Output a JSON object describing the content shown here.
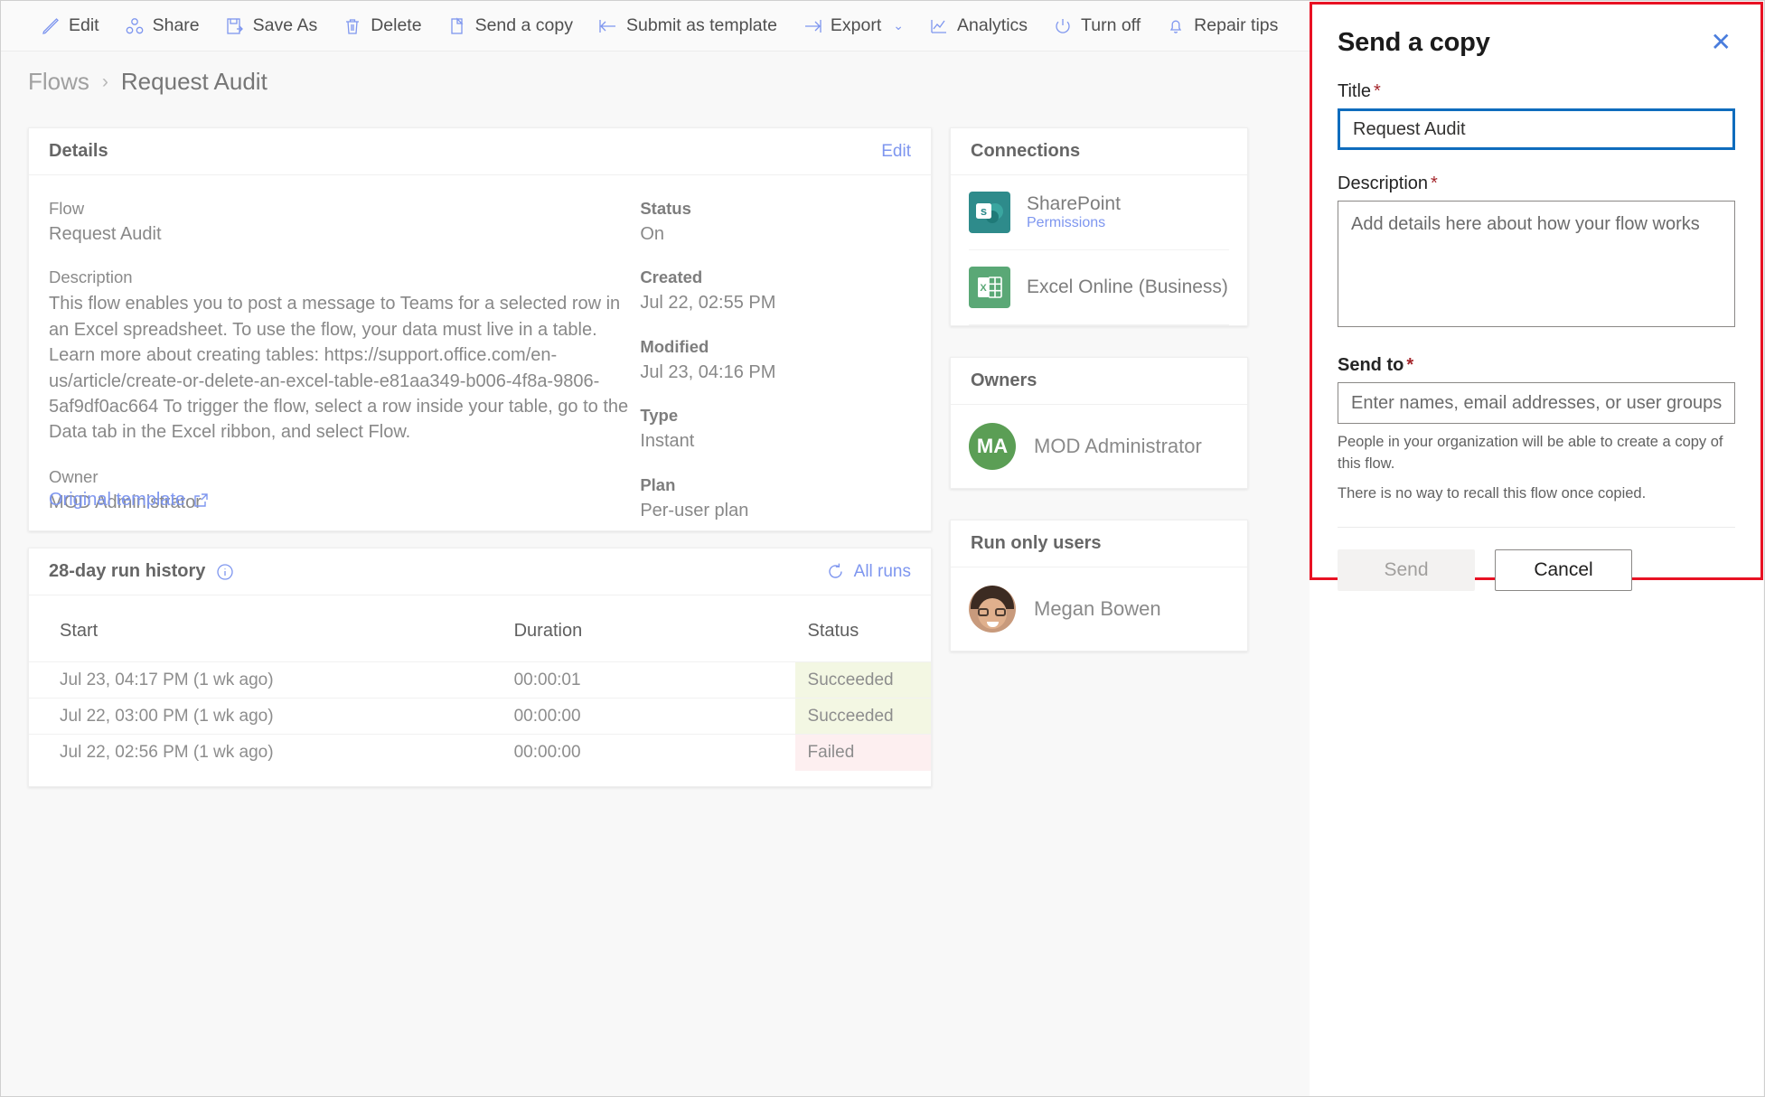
{
  "colors": {
    "accent_blue": "#7e96ef",
    "focus_blue": "#0f6cbd",
    "dialog_outline_red": "#e81123",
    "required_red": "#a4262c",
    "success_bg": "#f3f7e3",
    "failed_bg": "#fdeff0",
    "sharepoint_teal": "#2e8b8b",
    "excel_green": "#5aa876",
    "avatar_green": "#5b9e55"
  },
  "commandbar": {
    "items": [
      {
        "label": "Edit",
        "icon": "pencil-icon"
      },
      {
        "label": "Share",
        "icon": "share-icon"
      },
      {
        "label": "Save As",
        "icon": "save-as-icon"
      },
      {
        "label": "Delete",
        "icon": "trash-icon"
      },
      {
        "label": "Send a copy",
        "icon": "copy-icon"
      },
      {
        "label": "Submit as template",
        "icon": "arrow-left-bar-icon"
      },
      {
        "label": "Export",
        "icon": "arrow-right-bar-icon",
        "chevron": "⌄"
      },
      {
        "label": "Analytics",
        "icon": "chart-line-icon"
      },
      {
        "label": "Turn off",
        "icon": "power-icon"
      },
      {
        "label": "Repair tips",
        "icon": "bell-icon"
      }
    ]
  },
  "breadcrumb": {
    "parent": "Flows",
    "separator": "›",
    "current": "Request Audit"
  },
  "details": {
    "card_title": "Details",
    "edit_link": "Edit",
    "left": [
      {
        "label": "Flow",
        "value": "Request Audit"
      },
      {
        "label": "Description",
        "value": "This flow enables you to post a message to Teams for a selected row in an Excel spreadsheet. To use the flow, your data must live in a table. Learn more about creating tables: https://support.office.com/en-us/article/create-or-delete-an-excel-table-e81aa349-b006-4f8a-9806-5af9df0ac664 To trigger the flow, select a row inside your table, go to the Data tab in the Excel ribbon, and select Flow."
      },
      {
        "label": "Owner",
        "value": "MOD Administrator"
      }
    ],
    "right": [
      {
        "label": "Status",
        "value": "On"
      },
      {
        "label": "Created",
        "value": "Jul 22, 02:55 PM"
      },
      {
        "label": "Modified",
        "value": "Jul 23, 04:16 PM"
      },
      {
        "label": "Type",
        "value": "Instant"
      },
      {
        "label": "Plan",
        "value": "Per-user plan"
      }
    ],
    "original_template_link": "Original template"
  },
  "run_history": {
    "card_title": "28-day run history",
    "info_icon": "info-icon",
    "all_runs_link": "All runs",
    "refresh_icon": "refresh-icon",
    "columns": [
      "Start",
      "Duration",
      "Status"
    ],
    "rows": [
      {
        "start": "Jul 23, 04:17 PM (1 wk ago)",
        "duration": "00:00:01",
        "status": "Succeeded"
      },
      {
        "start": "Jul 22, 03:00 PM (1 wk ago)",
        "duration": "00:00:00",
        "status": "Succeeded"
      },
      {
        "start": "Jul 22, 02:56 PM (1 wk ago)",
        "duration": "00:00:00",
        "status": "Failed"
      }
    ]
  },
  "rail": {
    "connections": {
      "card_title": "Connections",
      "items": [
        {
          "name": "SharePoint",
          "sub": "Permissions",
          "icon": "sharepoint-icon"
        },
        {
          "name": "Excel Online (Business)",
          "sub": "",
          "icon": "excel-icon"
        }
      ]
    },
    "owners": {
      "card_title": "Owners",
      "items": [
        {
          "initials": "MA",
          "name": "MOD Administrator",
          "avatar": "initials-avatar"
        }
      ]
    },
    "run_only_users": {
      "card_title": "Run only users",
      "items": [
        {
          "name": "Megan Bowen",
          "avatar": "photo-avatar"
        }
      ]
    }
  },
  "panel": {
    "title": "Send a copy",
    "close_icon": "close-icon",
    "title_field": {
      "label": "Title",
      "required": "*",
      "value": "Request Audit",
      "focused": true
    },
    "description_field": {
      "label": "Description",
      "required": "*",
      "value": "",
      "placeholder": "Add details here about how your flow works"
    },
    "send_to_field": {
      "label": "Send to",
      "required": "*",
      "value": "",
      "placeholder": "Enter names, email addresses, or user groups"
    },
    "hints": [
      "People in your organization will be able to create a copy of this flow.",
      "There is no way to recall this flow once copied."
    ],
    "send_button": "Send",
    "send_button_disabled": true,
    "cancel_button": "Cancel"
  }
}
